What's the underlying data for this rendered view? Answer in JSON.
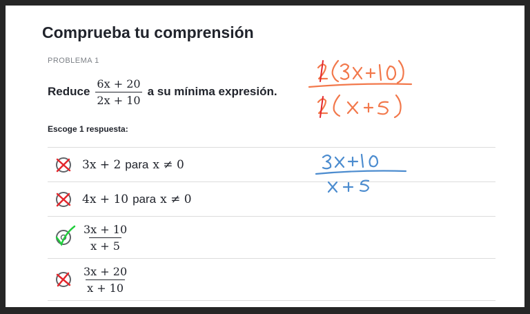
{
  "page": {
    "title": "Comprueba tu comprensión",
    "problem_label": "PROBLEMA 1",
    "question": {
      "before": "Reduce",
      "fraction": {
        "numerator": "6x + 20",
        "denominator": "2x + 10"
      },
      "after": "a su mínima expresión."
    },
    "prompt": "Escoge 1 respuesta:",
    "choices": [
      {
        "math": "3x + 2",
        "middle": "para",
        "condition": "x ≠ 0",
        "status": "crossed"
      },
      {
        "math": "4x + 10",
        "middle": "para",
        "condition": "x ≠ 0",
        "status": "crossed"
      },
      {
        "numerator": "3x + 10",
        "denominator": "x + 5",
        "status": "checked"
      },
      {
        "numerator": "3x + 20",
        "denominator": "x + 10",
        "status": "crossed"
      }
    ]
  },
  "colors": {
    "cross": "#e4262c",
    "check": "#1fce3b",
    "orange_ink": "#f2784b",
    "blue_ink": "#4c8ccf",
    "text": "#21242c"
  },
  "icons": [
    "circle-x-icon",
    "circle-check-icon"
  ]
}
